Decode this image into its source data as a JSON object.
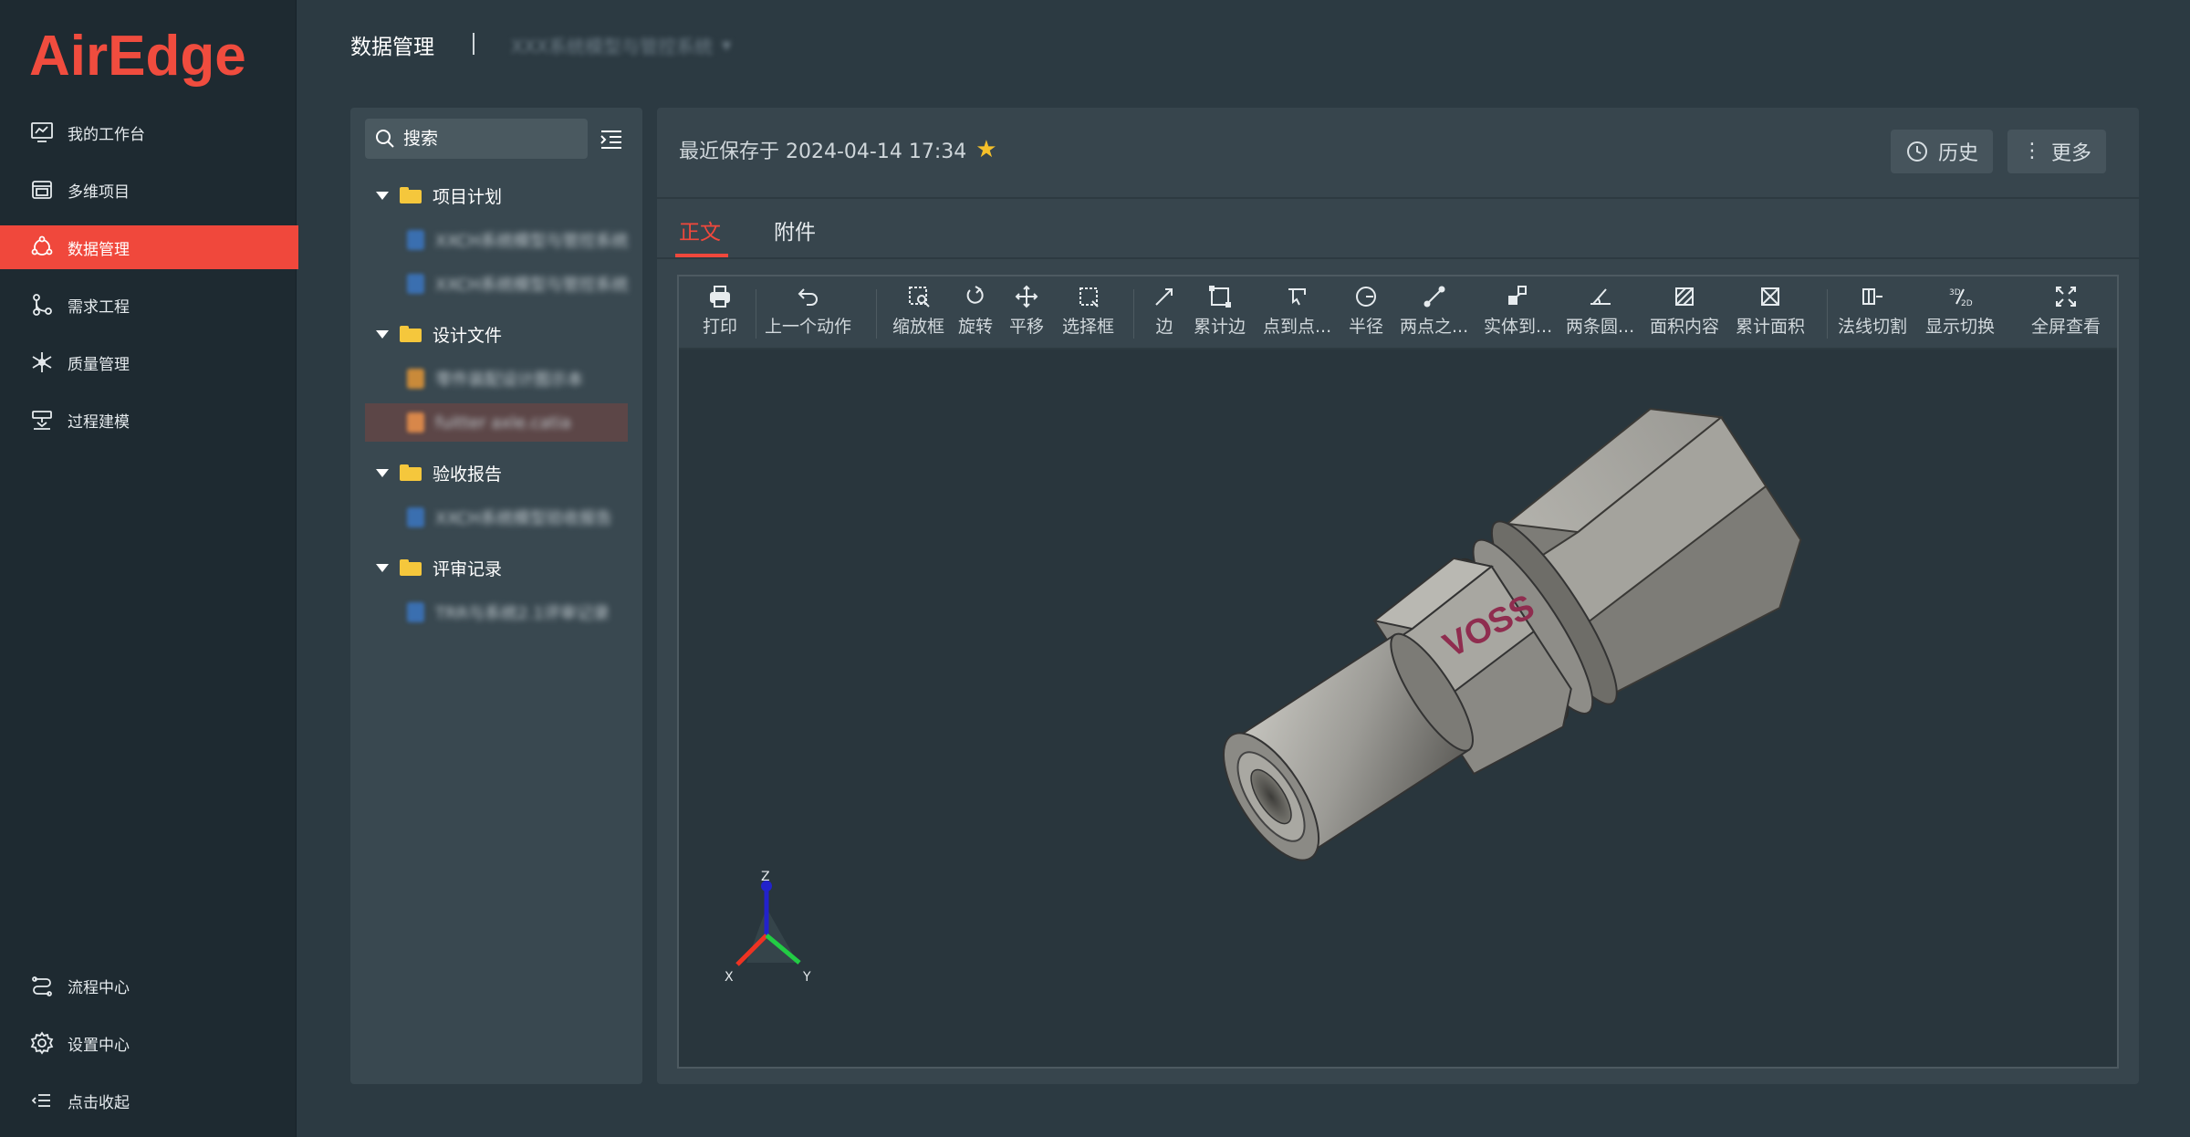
{
  "app": {
    "logo": "AirEdge"
  },
  "sidebar": {
    "items": [
      {
        "label": "我的工作台",
        "icon": "monitor-icon"
      },
      {
        "label": "多维项目",
        "icon": "layers-icon"
      },
      {
        "label": "数据管理",
        "icon": "share-nodes-icon",
        "active": true
      },
      {
        "label": "需求工程",
        "icon": "branch-icon"
      },
      {
        "label": "质量管理",
        "icon": "asterisk-icon"
      },
      {
        "label": "过程建模",
        "icon": "process-icon"
      }
    ],
    "bottom_items": [
      {
        "label": "流程中心",
        "icon": "flow-icon"
      },
      {
        "label": "设置中心",
        "icon": "gear-icon"
      },
      {
        "label": "点击收起",
        "icon": "collapse-icon"
      }
    ]
  },
  "header": {
    "title": "数据管理",
    "project": "XXX系统模型与管控系统"
  },
  "tree": {
    "search_placeholder": "搜索",
    "folders": [
      {
        "label": "项目计划",
        "files": [
          "XXCH系统模型与管控系统计划",
          "XXCH系统模型与管控系统里程碑"
        ]
      },
      {
        "label": "设计文件",
        "files": [
          "零件装配设计图示本",
          "fuitter axle.catia"
        ]
      },
      {
        "label": "验收报告",
        "files": [
          "XXCH系统模型验收报告"
        ]
      },
      {
        "label": "评审记录",
        "files": [
          "TRR与系统2.1评审记录"
        ]
      }
    ]
  },
  "main": {
    "save_label": "最近保存于 2024-04-14 17:34",
    "history_label": "历史",
    "more_label": "更多",
    "tabs": [
      "正文",
      "附件"
    ]
  },
  "toolbar": {
    "tools": [
      {
        "label": "打印",
        "icon": "printer-icon"
      },
      {
        "label": "上一个动作",
        "icon": "undo-icon"
      },
      {
        "label": "缩放框",
        "icon": "zoom-box-icon"
      },
      {
        "label": "旋转",
        "icon": "rotate-icon"
      },
      {
        "label": "平移",
        "icon": "move-icon"
      },
      {
        "label": "选择框",
        "icon": "select-box-icon"
      },
      {
        "label": "边",
        "icon": "edge-icon"
      },
      {
        "label": "累计边",
        "icon": "cumulative-edge-icon"
      },
      {
        "label": "点到点...",
        "icon": "point-to-point-icon"
      },
      {
        "label": "半径",
        "icon": "radius-icon"
      },
      {
        "label": "两点之...",
        "icon": "two-points-icon"
      },
      {
        "label": "实体到...",
        "icon": "entity-to-icon"
      },
      {
        "label": "两条圆...",
        "icon": "two-circles-icon"
      },
      {
        "label": "面积内容",
        "icon": "area-icon"
      },
      {
        "label": "累计面积",
        "icon": "cumulative-area-icon"
      },
      {
        "label": "法线切割",
        "icon": "normal-cut-icon"
      },
      {
        "label": "显示切换",
        "icon": "3d-2d-toggle-icon"
      },
      {
        "label": "全屏查看",
        "icon": "fullscreen-icon"
      }
    ]
  },
  "model": {
    "engraving": "VOSS",
    "axes": {
      "x": "X",
      "y": "Y",
      "z": "Z"
    }
  },
  "colors": {
    "accent": "#f0483c",
    "star": "#f5c02a"
  }
}
